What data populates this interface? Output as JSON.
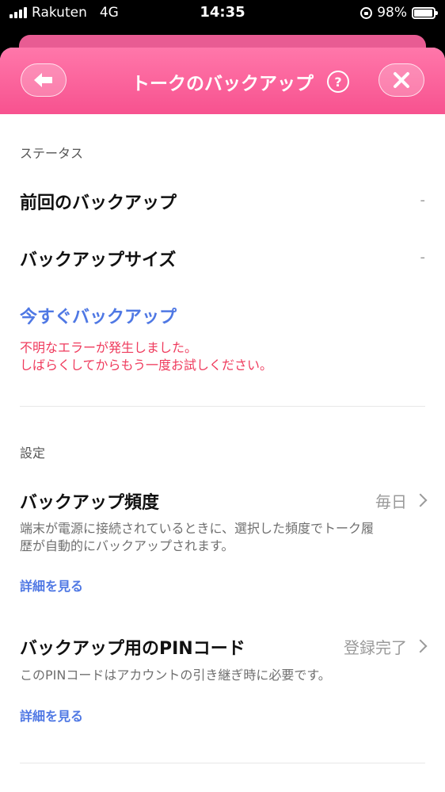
{
  "status_bar": {
    "carrier": "Rakuten",
    "network": "4G",
    "time": "14:35",
    "battery": "98%"
  },
  "header": {
    "title": "トークのバックアップ",
    "help_label": "?"
  },
  "status_section": {
    "label": "ステータス",
    "last_backup": {
      "label": "前回のバックアップ",
      "value": "-"
    },
    "backup_size": {
      "label": "バックアップサイズ",
      "value": "-"
    },
    "backup_now": "今すぐバックアップ",
    "error_line1": "不明なエラーが発生しました。",
    "error_line2": "しばらくしてからもう一度お試しください。"
  },
  "settings_section": {
    "label": "設定",
    "frequency": {
      "label": "バックアップ頻度",
      "value": "毎日",
      "desc_line1": "端末が電源に接続されているときに、選択した頻度でトーク履",
      "desc_line2": "歴が自動的にバックアップされます。",
      "detail_link": "詳細を見る"
    },
    "pin": {
      "label": "バックアップ用のPINコード",
      "value": "登録完了",
      "desc": "このPINコードはアカウントの引き継ぎ時に必要です。",
      "detail_link": "詳細を見る"
    }
  },
  "colors": {
    "header_pink": "#f7528f",
    "link_blue": "#4f78e4",
    "error_red": "#ef3b5d"
  }
}
